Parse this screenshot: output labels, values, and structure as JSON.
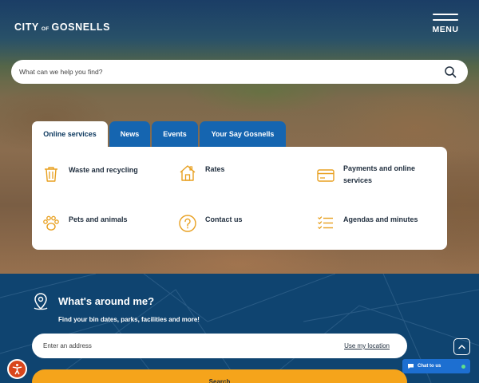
{
  "header": {
    "logo_city": "CITY",
    "logo_of": "OF",
    "logo_name": "GOSNELLS",
    "menu_label": "MENU"
  },
  "search": {
    "placeholder": "What can we help you find?",
    "icon": "search-icon"
  },
  "tabs": [
    {
      "label": "Online services",
      "active": true
    },
    {
      "label": "News",
      "active": false
    },
    {
      "label": "Events",
      "active": false
    },
    {
      "label": "Your Say Gosnells",
      "active": false
    }
  ],
  "services": [
    {
      "label": "Waste and recycling",
      "icon": "bin-icon"
    },
    {
      "label": "Rates",
      "icon": "house-icon"
    },
    {
      "label": "Payments and online services",
      "icon": "card-icon"
    },
    {
      "label": "Pets and animals",
      "icon": "paw-icon"
    },
    {
      "label": "Contact us",
      "icon": "question-icon"
    },
    {
      "label": "Agendas and minutes",
      "icon": "list-icon"
    }
  ],
  "around": {
    "title": "What's around me?",
    "subtitle": "Find your bin dates, parks, facilities and more!",
    "address_placeholder": "Enter an address",
    "use_location": "Use my location",
    "search_button": "Search"
  },
  "widgets": {
    "chat_label": "Chat to us",
    "back_to_top_icon": "chevron-up-icon",
    "accessibility_icon": "accessibility-icon"
  },
  "colors": {
    "brand_navy": "#0f4470",
    "tab_blue": "#1565b0",
    "accent_orange": "#f5a41b",
    "icon_orange": "#e8a020"
  }
}
